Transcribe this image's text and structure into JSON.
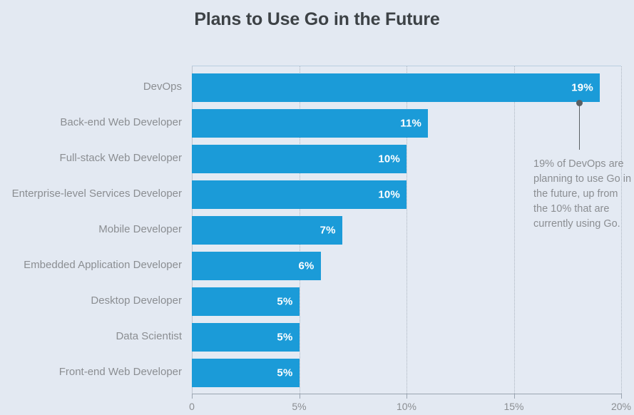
{
  "chart_data": {
    "type": "bar",
    "orientation": "horizontal",
    "title": "Plans to Use Go in the Future",
    "xlabel": "",
    "ylabel": "",
    "categories": [
      "DevOps",
      "Back-end Web Developer",
      "Full-stack Web Developer",
      "Enterprise-level Services Developer",
      "Mobile Developer",
      "Embedded Application Developer",
      "Desktop Developer",
      "Data Scientist",
      "Front-end Web Developer"
    ],
    "values": [
      19,
      11,
      10,
      10,
      7,
      6,
      5,
      5,
      5
    ],
    "value_labels": [
      "19%",
      "11%",
      "10%",
      "10%",
      "7%",
      "6%",
      "5%",
      "5%",
      "5%"
    ],
    "xlim": [
      0,
      20
    ],
    "xticks": [
      0,
      5,
      10,
      15,
      20
    ],
    "xtick_labels": [
      "0",
      "5%",
      "10%",
      "15%",
      "20%"
    ],
    "grid": true,
    "legend": false,
    "bar_color": "#1b9bd8",
    "background_color": "#e3e9f2",
    "plot_background_color": "#e4eaf3",
    "label_color": "#8b8e92",
    "title_color": "#3d4246",
    "value_label_color": "#ffffff",
    "annotation": {
      "text": "19% of DevOps are planning to use Go in the future, up from the 10% that are currently using Go.",
      "target_category": "DevOps",
      "marker_color": "#5a5f63"
    }
  }
}
